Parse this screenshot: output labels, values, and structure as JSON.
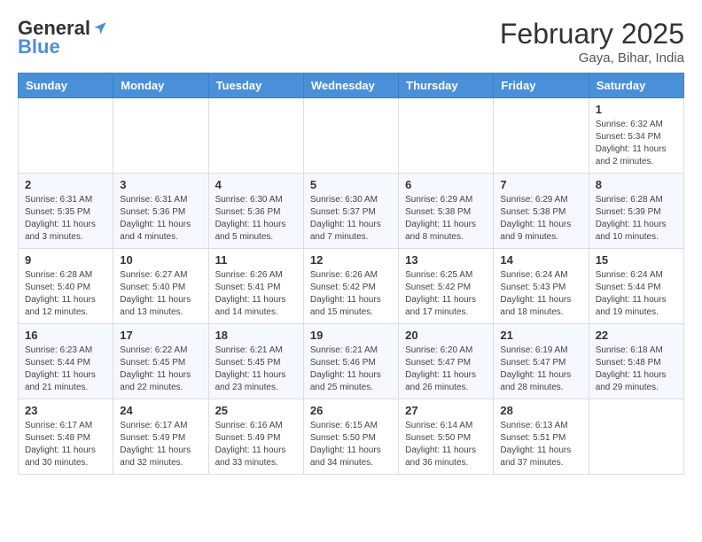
{
  "logo": {
    "line1": "General",
    "line2": "Blue"
  },
  "title": "February 2025",
  "location": "Gaya, Bihar, India",
  "weekdays": [
    "Sunday",
    "Monday",
    "Tuesday",
    "Wednesday",
    "Thursday",
    "Friday",
    "Saturday"
  ],
  "weeks": [
    [
      {
        "day": "",
        "info": ""
      },
      {
        "day": "",
        "info": ""
      },
      {
        "day": "",
        "info": ""
      },
      {
        "day": "",
        "info": ""
      },
      {
        "day": "",
        "info": ""
      },
      {
        "day": "",
        "info": ""
      },
      {
        "day": "1",
        "info": "Sunrise: 6:32 AM\nSunset: 5:34 PM\nDaylight: 11 hours\nand 2 minutes."
      }
    ],
    [
      {
        "day": "2",
        "info": "Sunrise: 6:31 AM\nSunset: 5:35 PM\nDaylight: 11 hours\nand 3 minutes."
      },
      {
        "day": "3",
        "info": "Sunrise: 6:31 AM\nSunset: 5:36 PM\nDaylight: 11 hours\nand 4 minutes."
      },
      {
        "day": "4",
        "info": "Sunrise: 6:30 AM\nSunset: 5:36 PM\nDaylight: 11 hours\nand 5 minutes."
      },
      {
        "day": "5",
        "info": "Sunrise: 6:30 AM\nSunset: 5:37 PM\nDaylight: 11 hours\nand 7 minutes."
      },
      {
        "day": "6",
        "info": "Sunrise: 6:29 AM\nSunset: 5:38 PM\nDaylight: 11 hours\nand 8 minutes."
      },
      {
        "day": "7",
        "info": "Sunrise: 6:29 AM\nSunset: 5:38 PM\nDaylight: 11 hours\nand 9 minutes."
      },
      {
        "day": "8",
        "info": "Sunrise: 6:28 AM\nSunset: 5:39 PM\nDaylight: 11 hours\nand 10 minutes."
      }
    ],
    [
      {
        "day": "9",
        "info": "Sunrise: 6:28 AM\nSunset: 5:40 PM\nDaylight: 11 hours\nand 12 minutes."
      },
      {
        "day": "10",
        "info": "Sunrise: 6:27 AM\nSunset: 5:40 PM\nDaylight: 11 hours\nand 13 minutes."
      },
      {
        "day": "11",
        "info": "Sunrise: 6:26 AM\nSunset: 5:41 PM\nDaylight: 11 hours\nand 14 minutes."
      },
      {
        "day": "12",
        "info": "Sunrise: 6:26 AM\nSunset: 5:42 PM\nDaylight: 11 hours\nand 15 minutes."
      },
      {
        "day": "13",
        "info": "Sunrise: 6:25 AM\nSunset: 5:42 PM\nDaylight: 11 hours\nand 17 minutes."
      },
      {
        "day": "14",
        "info": "Sunrise: 6:24 AM\nSunset: 5:43 PM\nDaylight: 11 hours\nand 18 minutes."
      },
      {
        "day": "15",
        "info": "Sunrise: 6:24 AM\nSunset: 5:44 PM\nDaylight: 11 hours\nand 19 minutes."
      }
    ],
    [
      {
        "day": "16",
        "info": "Sunrise: 6:23 AM\nSunset: 5:44 PM\nDaylight: 11 hours\nand 21 minutes."
      },
      {
        "day": "17",
        "info": "Sunrise: 6:22 AM\nSunset: 5:45 PM\nDaylight: 11 hours\nand 22 minutes."
      },
      {
        "day": "18",
        "info": "Sunrise: 6:21 AM\nSunset: 5:45 PM\nDaylight: 11 hours\nand 23 minutes."
      },
      {
        "day": "19",
        "info": "Sunrise: 6:21 AM\nSunset: 5:46 PM\nDaylight: 11 hours\nand 25 minutes."
      },
      {
        "day": "20",
        "info": "Sunrise: 6:20 AM\nSunset: 5:47 PM\nDaylight: 11 hours\nand 26 minutes."
      },
      {
        "day": "21",
        "info": "Sunrise: 6:19 AM\nSunset: 5:47 PM\nDaylight: 11 hours\nand 28 minutes."
      },
      {
        "day": "22",
        "info": "Sunrise: 6:18 AM\nSunset: 5:48 PM\nDaylight: 11 hours\nand 29 minutes."
      }
    ],
    [
      {
        "day": "23",
        "info": "Sunrise: 6:17 AM\nSunset: 5:48 PM\nDaylight: 11 hours\nand 30 minutes."
      },
      {
        "day": "24",
        "info": "Sunrise: 6:17 AM\nSunset: 5:49 PM\nDaylight: 11 hours\nand 32 minutes."
      },
      {
        "day": "25",
        "info": "Sunrise: 6:16 AM\nSunset: 5:49 PM\nDaylight: 11 hours\nand 33 minutes."
      },
      {
        "day": "26",
        "info": "Sunrise: 6:15 AM\nSunset: 5:50 PM\nDaylight: 11 hours\nand 34 minutes."
      },
      {
        "day": "27",
        "info": "Sunrise: 6:14 AM\nSunset: 5:50 PM\nDaylight: 11 hours\nand 36 minutes."
      },
      {
        "day": "28",
        "info": "Sunrise: 6:13 AM\nSunset: 5:51 PM\nDaylight: 11 hours\nand 37 minutes."
      },
      {
        "day": "",
        "info": ""
      }
    ]
  ]
}
